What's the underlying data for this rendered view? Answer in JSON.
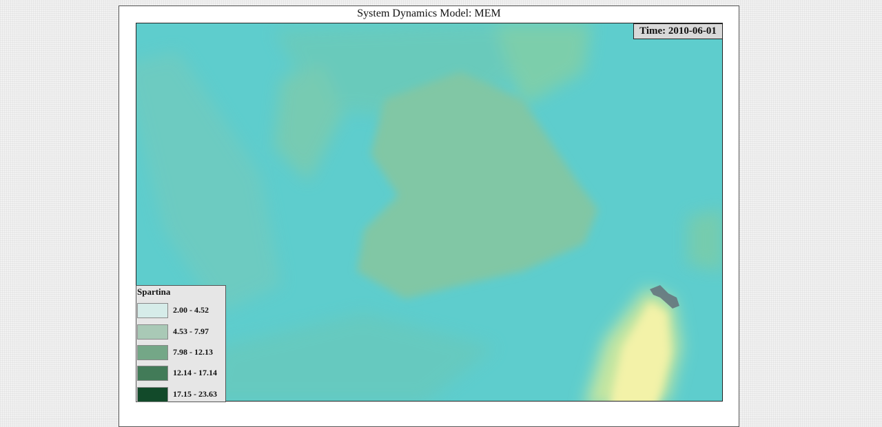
{
  "title": "System Dynamics Model: MEM",
  "time_label": "Time: 2010-06-01",
  "legend": {
    "title": "Spartina",
    "items": [
      {
        "label": "2.00 - 4.52",
        "color": "#d6ece9"
      },
      {
        "label": "4.53 - 7.97",
        "color": "#a9c9b6"
      },
      {
        "label": "7.98 - 12.13",
        "color": "#74a787"
      },
      {
        "label": "12.14 - 17.14",
        "color": "#427b58"
      },
      {
        "label": "17.15 - 23.63",
        "color": "#124a2a"
      }
    ]
  },
  "colors": {
    "water": "#5ecdcd",
    "marsh": "#7cc9a8",
    "high_marsh": "#f3f2a8"
  }
}
